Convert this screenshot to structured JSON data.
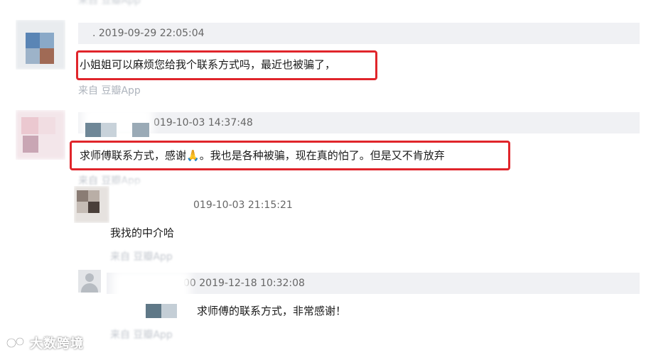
{
  "comments": [
    {
      "meta": ". 2019-09-29 22:05:04",
      "text": "小姐姐可以麻烦您给我个联系方式吗，最近也被骗了，",
      "source": "来自 豆瓣App"
    },
    {
      "meta": "019-10-03 14:37:48",
      "text_before": "求师傅联系方式，感谢",
      "emoji": "🙏",
      "text_after": "。我也是各种被骗，现在真的怕了。但是又不肯放弃",
      "source": "来自 豆瓣App"
    },
    {
      "meta": "019-10-03 21:15:21",
      "text": "我找的中介哈",
      "source": "来自 豆瓣App"
    },
    {
      "meta": "00 2019-12-18 10:32:08",
      "text": "求师傅的联系方式，非常感谢！",
      "source": "来自 豆瓣App"
    }
  ],
  "top_fragment": "来自 豆瓣App",
  "watermark": "大数跨境",
  "colors": {
    "highlight": "#e0252b",
    "meta_bg": "#f0f1f4",
    "source_text": "#aeb4bd"
  }
}
